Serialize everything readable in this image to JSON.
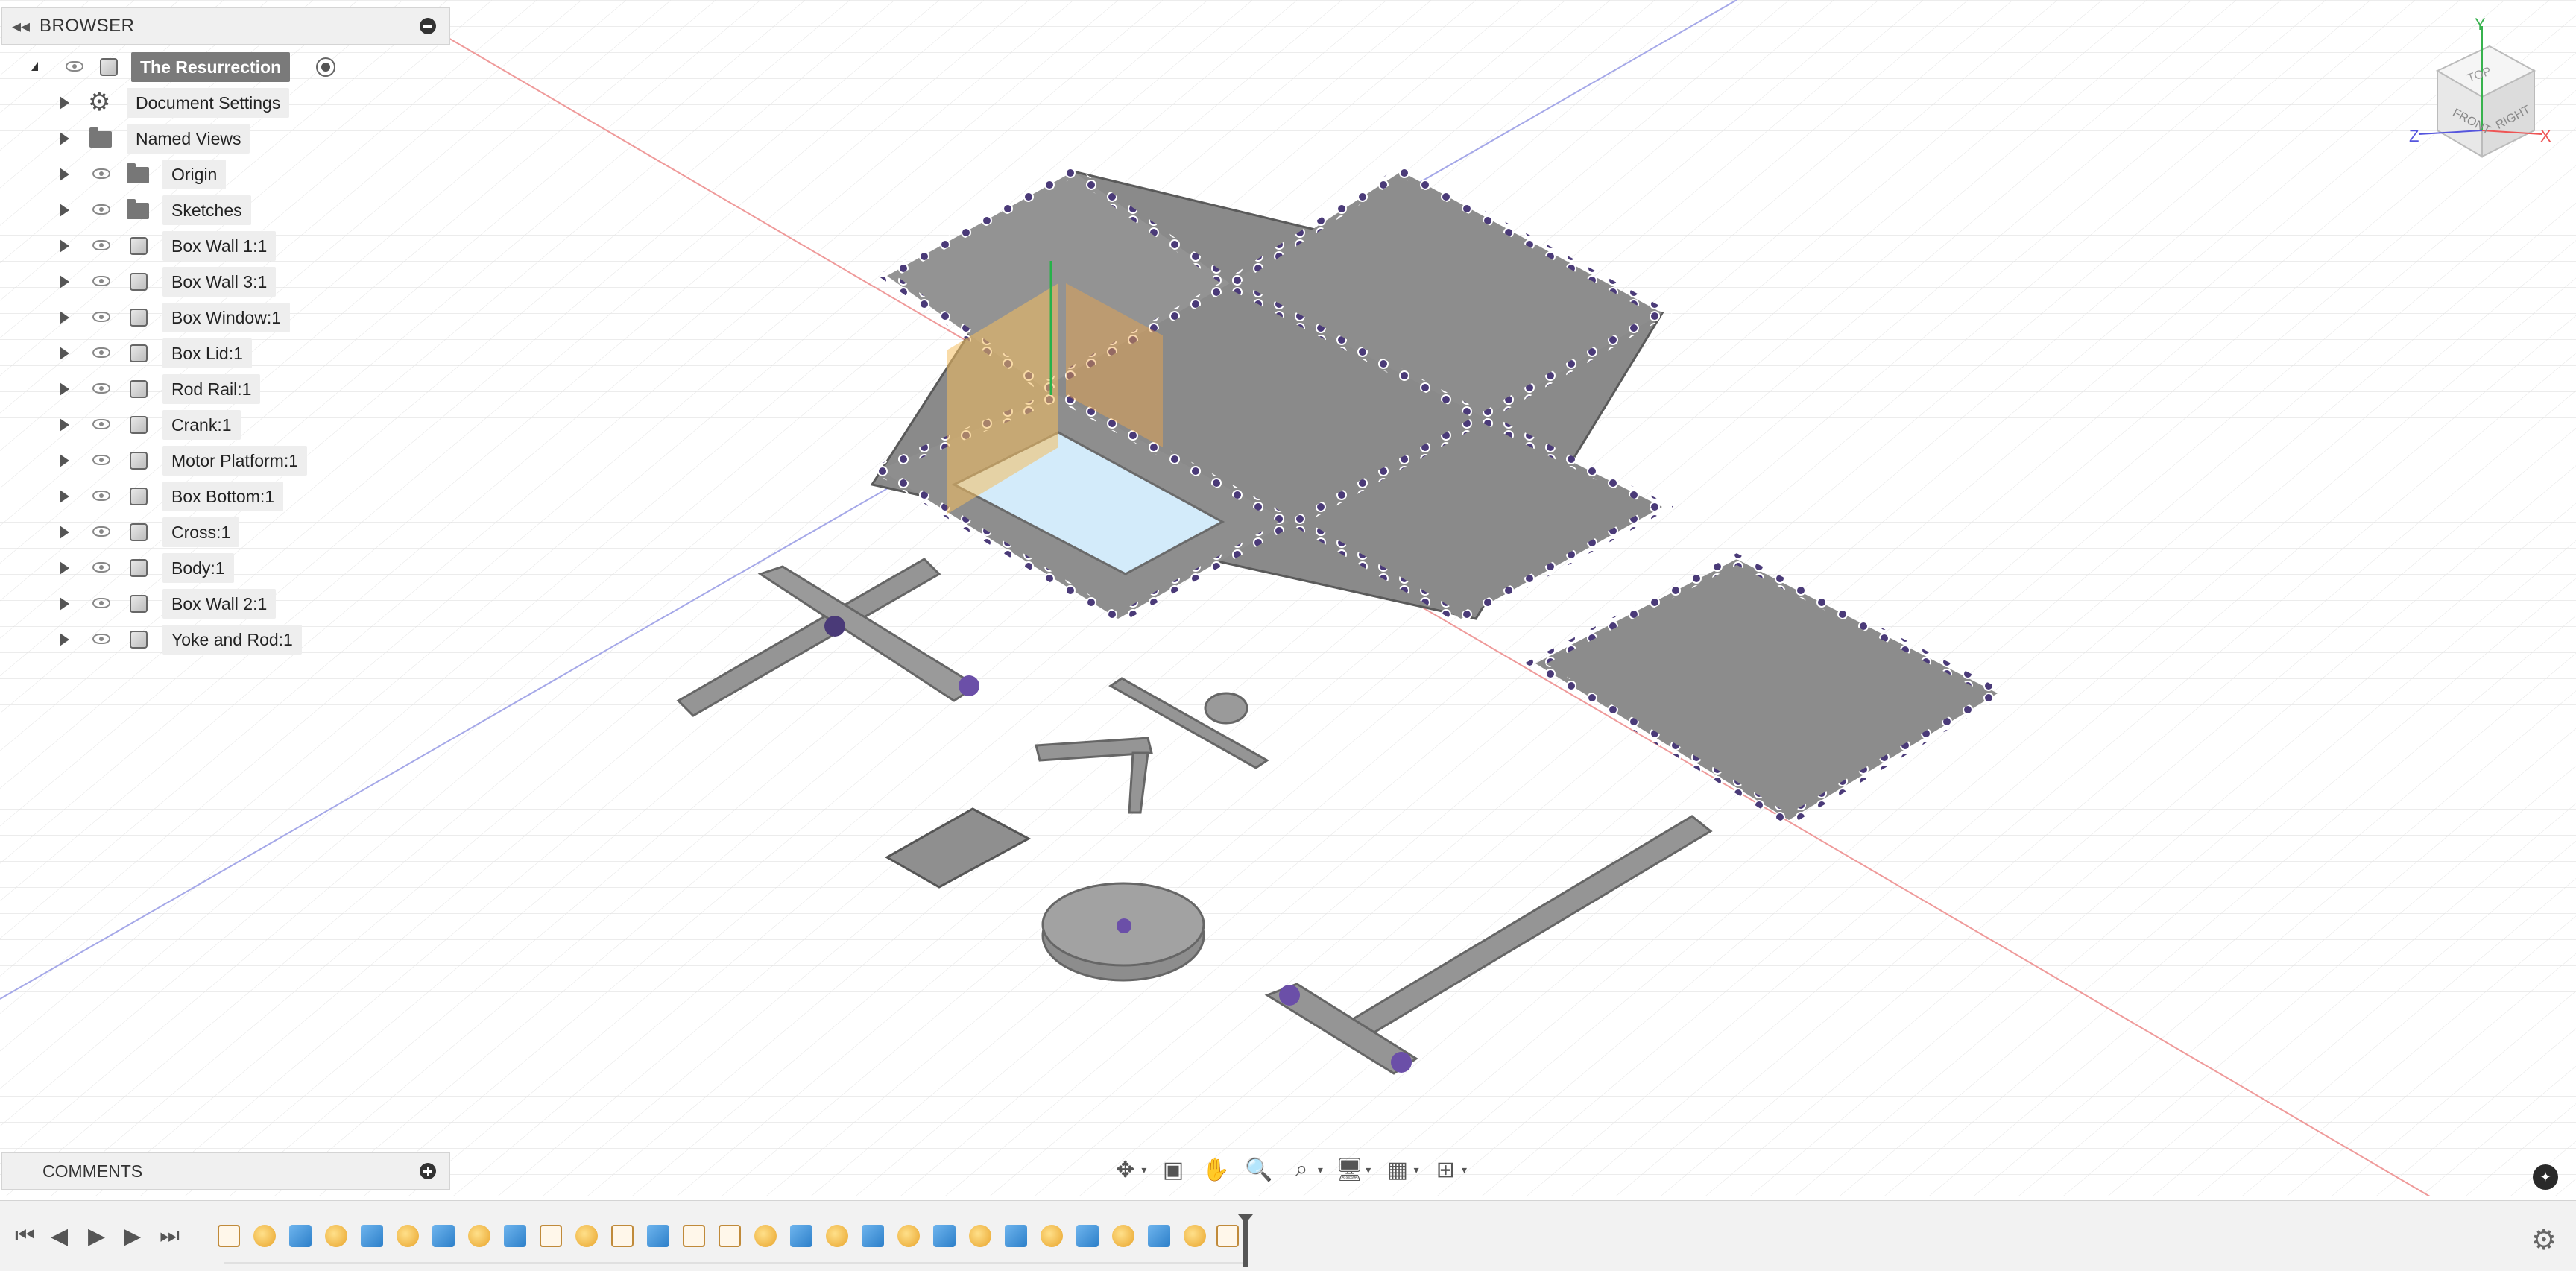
{
  "browser": {
    "title": "BROWSER",
    "root_label": "The Resurrection",
    "items": [
      {
        "label": "Document Settings",
        "icon": "gear-icon"
      },
      {
        "label": "Named Views",
        "icon": "folder-icon"
      },
      {
        "label": "Origin",
        "icon": "folder-icon"
      },
      {
        "label": "Sketches",
        "icon": "folder-icon"
      },
      {
        "label": "Box Wall 1:1",
        "icon": "component-icon"
      },
      {
        "label": "Box Wall 3:1",
        "icon": "component-icon"
      },
      {
        "label": "Box Window:1",
        "icon": "component-icon"
      },
      {
        "label": "Box Lid:1",
        "icon": "component-icon"
      },
      {
        "label": "Rod Rail:1",
        "icon": "component-icon"
      },
      {
        "label": "Crank:1",
        "icon": "component-icon"
      },
      {
        "label": "Motor Platform:1",
        "icon": "component-icon"
      },
      {
        "label": "Box Bottom:1",
        "icon": "component-icon"
      },
      {
        "label": "Cross:1",
        "icon": "component-icon"
      },
      {
        "label": "Body:1",
        "icon": "component-icon"
      },
      {
        "label": "Box Wall 2:1",
        "icon": "component-icon"
      },
      {
        "label": "Yoke and Rod:1",
        "icon": "component-icon"
      }
    ]
  },
  "comments": {
    "title": "COMMENTS"
  },
  "viewcube": {
    "top": "TOP",
    "front": "FRONT",
    "right": "RIGHT",
    "axis_x": "X",
    "axis_y": "Y",
    "axis_z": "Z"
  },
  "colors": {
    "part_gray": "#8f8f8f",
    "fastener_purple": "#6b4fa8",
    "accent_orange": "#f2b84b",
    "accent_blue": "#cfe6f7"
  }
}
